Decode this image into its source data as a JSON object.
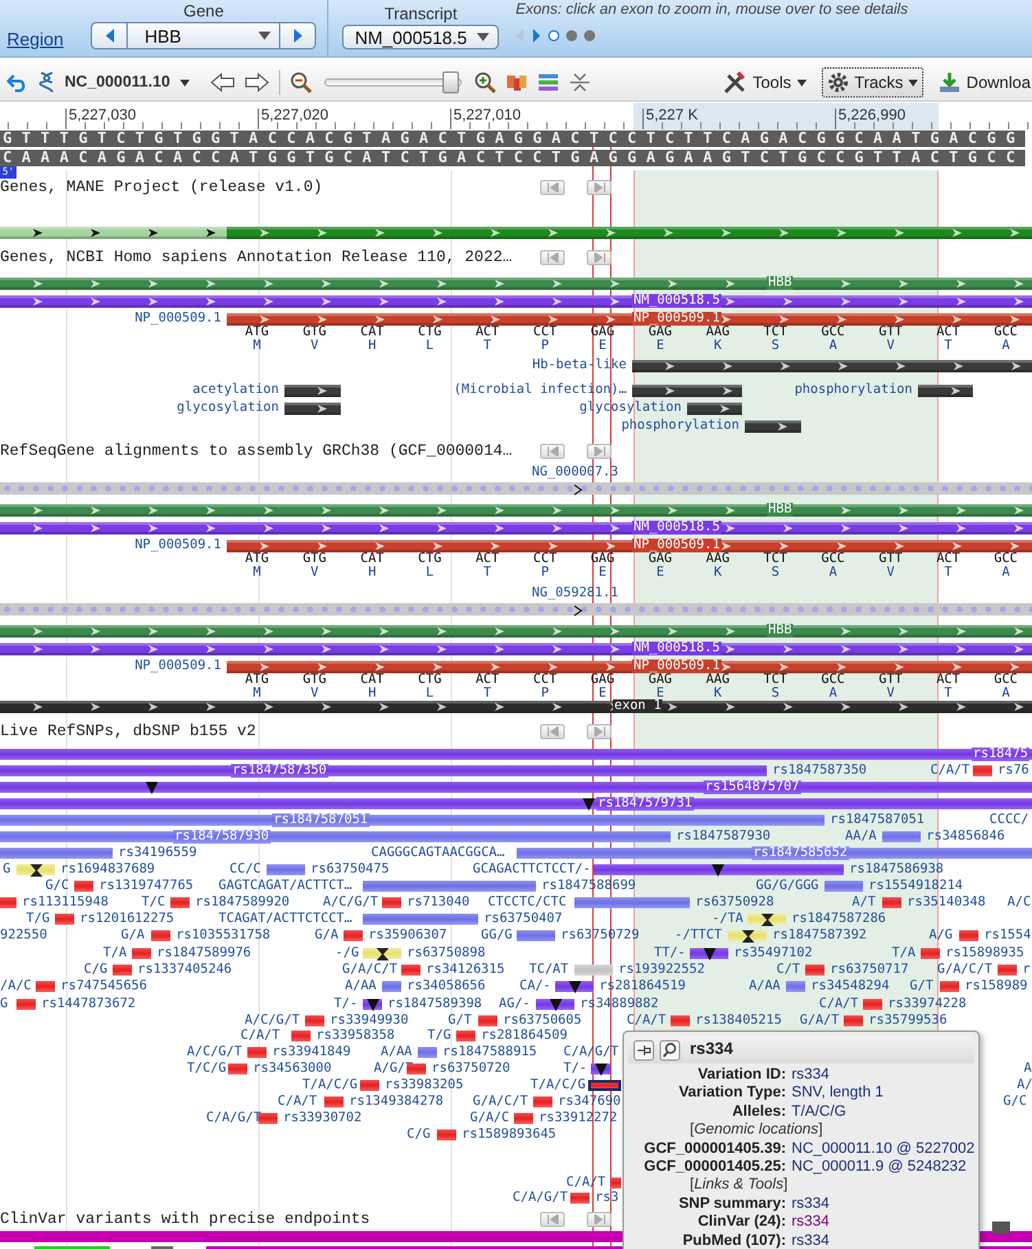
{
  "header": {
    "region_link": "Region",
    "gene": {
      "label": "Gene",
      "value": "HBB"
    },
    "transcript": {
      "label": "Transcript",
      "value": "NM_000518.5"
    },
    "exon_hint": "Exons: click an exon to zoom in, mouse over to see details",
    "exons": [
      {
        "selected": true
      },
      {
        "selected": false
      },
      {
        "selected": false
      }
    ]
  },
  "toolbar": {
    "accession": "NC_000011.10",
    "zoom_slider": {
      "level": 0.92
    },
    "tools": "Tools",
    "tracks": "Tracks",
    "download": "Downloa"
  },
  "ruler": {
    "ticks": [
      "5,227,030",
      "5,227,020",
      "5,227,010",
      "5,227 K",
      "5,226,990"
    ]
  },
  "sequence": {
    "forward": "GTTTGTCTGTGGTACCACGTAGACTGAGGACTCCTCTTCAGACGGCAATGACGG",
    "reverse": "CAAACAGACACCATGGTGCATCTGACTCCTGAGGAGAAGTCTGCCGTTACTGCC",
    "strand_badge": "5'"
  },
  "tracks": [
    {
      "kind": "mane",
      "title": "Genes, MANE Project (release v1.0)"
    },
    {
      "kind": "genes",
      "title": "Genes, NCBI Homo sapiens Annotation Release 110, 2022…",
      "gene": "HBB",
      "transcript": "NM_000518.5",
      "protein_outside": "NP_000509.1",
      "protein": "NP_000509.1",
      "codons": [
        {
          "codon": "ATG",
          "aa": "M"
        },
        {
          "codon": "GTG",
          "aa": "V"
        },
        {
          "codon": "CAT",
          "aa": "H"
        },
        {
          "codon": "CTG",
          "aa": "L"
        },
        {
          "codon": "ACT",
          "aa": "T"
        },
        {
          "codon": "CCT",
          "aa": "P"
        },
        {
          "codon": "GAG",
          "aa": "E"
        },
        {
          "codon": "GAG",
          "aa": "E"
        },
        {
          "codon": "AAG",
          "aa": "K"
        },
        {
          "codon": "TCT",
          "aa": "S"
        },
        {
          "codon": "GCC",
          "aa": "A"
        },
        {
          "codon": "GTT",
          "aa": "V"
        },
        {
          "codon": "ACT",
          "aa": "T"
        },
        {
          "codon": "GCC",
          "aa": "A"
        }
      ],
      "features": [
        {
          "label": "Hb-beta-like"
        },
        {
          "label": "acetylation"
        },
        {
          "label": "glycosylation"
        },
        {
          "label": "(Microbial infection)…"
        },
        {
          "label": "phosphorylation"
        },
        {
          "label": "glycosylation"
        },
        {
          "label": "phosphorylation"
        }
      ]
    },
    {
      "kind": "alignments",
      "title": "RefSeqGene alignments to assembly GRCh38 (GCF_0000014…",
      "alignments": [
        {
          "accession": "NG_000007.3",
          "gene": "HBB",
          "transcript": "NM_000518.5",
          "protein_outside": "NP_000509.1",
          "protein": "NP_000509.1",
          "codons": [
            {
              "codon": "ATG",
              "aa": "M"
            },
            {
              "codon": "GTG",
              "aa": "V"
            },
            {
              "codon": "CAT",
              "aa": "H"
            },
            {
              "codon": "CTG",
              "aa": "L"
            },
            {
              "codon": "ACT",
              "aa": "T"
            },
            {
              "codon": "CCT",
              "aa": "P"
            },
            {
              "codon": "GAG",
              "aa": "E"
            },
            {
              "codon": "GAG",
              "aa": "E"
            },
            {
              "codon": "AAG",
              "aa": "K"
            },
            {
              "codon": "TCT",
              "aa": "S"
            },
            {
              "codon": "GCC",
              "aa": "A"
            },
            {
              "codon": "GTT",
              "aa": "V"
            },
            {
              "codon": "ACT",
              "aa": "T"
            },
            {
              "codon": "GCC",
              "aa": "A"
            }
          ]
        },
        {
          "accession": "NG_059281.1",
          "gene": "HBB",
          "transcript": "NM_000518.5",
          "protein_outside": "NP_000509.1",
          "protein": "NP_000509.1",
          "codons": [
            {
              "codon": "ATG",
              "aa": "M"
            },
            {
              "codon": "GTG",
              "aa": "V"
            },
            {
              "codon": "CAT",
              "aa": "H"
            },
            {
              "codon": "CTG",
              "aa": "L"
            },
            {
              "codon": "ACT",
              "aa": "T"
            },
            {
              "codon": "CCT",
              "aa": "P"
            },
            {
              "codon": "GAG",
              "aa": "E"
            },
            {
              "codon": "GAG",
              "aa": "E"
            },
            {
              "codon": "AAG",
              "aa": "K"
            },
            {
              "codon": "TCT",
              "aa": "S"
            },
            {
              "codon": "GCC",
              "aa": "A"
            },
            {
              "codon": "GTT",
              "aa": "V"
            },
            {
              "codon": "ACT",
              "aa": "T"
            },
            {
              "codon": "GCC",
              "aa": "A"
            }
          ],
          "exon": "exon 1"
        }
      ]
    },
    {
      "kind": "snps",
      "title": "Live RefSNPs, dbSNP b155 v2",
      "lanes": [
        {
          "variants": [
            {
              "kind": "purple",
              "inside_label": "rs18475",
              "selected": false
            }
          ]
        },
        {
          "variants": [
            {
              "kind": "purple",
              "inside_label": "rs1847587350",
              "label": "rs1847587350",
              "selected": false
            },
            {
              "allele": "C/A/T",
              "kind": "red",
              "label": "rs76",
              "selected": false
            }
          ]
        },
        {
          "variants": [
            {
              "kind": "purple",
              "deletion": true,
              "inside_label": "rs1564875707",
              "selected": false
            }
          ]
        },
        {
          "variants": [
            {
              "kind": "purple",
              "deletion": true,
              "inside_label": "rs1847579731",
              "selected": false
            }
          ]
        },
        {
          "variants": [
            {
              "kind": "blue",
              "inside_label": "rs1847587051",
              "label": "rs1847587051",
              "selected": false
            },
            {
              "allele": "CCCC/",
              "kind": "none",
              "selected": false
            }
          ]
        },
        {
          "variants": [
            {
              "kind": "blue",
              "inside_label": "rs1847587930",
              "label": "rs1847587930",
              "selected": false
            },
            {
              "allele": "AA/A",
              "kind": "blue",
              "label": "rs34856846",
              "selected": false
            }
          ]
        },
        {
          "variants": [
            {
              "kind": "blue",
              "label": "rs34196559",
              "selected": false
            },
            {
              "allele": "CAGGGCAGTAACGGCA…",
              "kind": "blue",
              "inside_label": "rs1847585652",
              "selected": false
            }
          ]
        },
        {
          "variants": [
            {
              "allele": "G",
              "kind": "yellow",
              "insertion": true,
              "label": "rs1694837689",
              "selected": false
            },
            {
              "allele": "CC/C",
              "kind": "blue",
              "label": "rs63750475",
              "selected": false
            },
            {
              "allele": "GCAGACTTCTCCT/-",
              "kind": "purple",
              "deletion": true,
              "label": "rs1847586938",
              "selected": false
            }
          ]
        },
        {
          "variants": [
            {
              "allele": "G/C",
              "kind": "red",
              "label": "rs1319747765",
              "selected": false
            },
            {
              "allele": "GAGTCAGAT/ACTTCT…",
              "kind": "blue",
              "label": "rs1847588699",
              "selected": false
            },
            {
              "allele": "GG/G/GGG",
              "kind": "blue",
              "label": "rs1554918214",
              "selected": false
            }
          ]
        },
        {
          "variants": [
            {
              "kind": "red",
              "label": "rs113115948",
              "selected": false
            },
            {
              "allele": "T/C",
              "kind": "red",
              "label": "rs1847589920",
              "selected": false
            },
            {
              "allele": "A/C/G/T",
              "kind": "red",
              "label": "rs713040",
              "selected": false
            },
            {
              "allele": "CTCCTC/CTC",
              "kind": "blue",
              "label": "rs63750928",
              "selected": false
            },
            {
              "allele": "A/T",
              "kind": "red",
              "label": "rs35140348",
              "selected": false
            },
            {
              "allele": "A/C",
              "kind": "none",
              "selected": false
            }
          ]
        },
        {
          "variants": [
            {
              "allele": "T/G",
              "kind": "red",
              "label": "rs1201612275",
              "selected": false
            },
            {
              "allele": "TCAGAT/ACTTCTCCT…",
              "kind": "blue",
              "label": "rs63750407",
              "selected": false
            },
            {
              "allele": "-/TA",
              "kind": "yellow",
              "insertion": true,
              "label": "rs1847587286",
              "selected": false
            }
          ]
        },
        {
          "variants": [
            {
              "kind": "none",
              "label": "922550",
              "selected": false
            },
            {
              "allele": "G/A",
              "kind": "red",
              "label": "rs1035531758",
              "selected": false
            },
            {
              "allele": "G/A",
              "kind": "red",
              "label": "rs35906307",
              "selected": false
            },
            {
              "allele": "GG/G",
              "kind": "blue",
              "label": "rs63750729",
              "selected": false
            },
            {
              "allele": "-/TTCT",
              "kind": "yellow",
              "insertion": true,
              "label": "rs1847587392",
              "selected": false
            },
            {
              "allele": "A/G",
              "kind": "red",
              "label": "rs1554",
              "selected": false
            }
          ]
        },
        {
          "variants": [
            {
              "allele": "T/A",
              "kind": "red",
              "label": "rs1847589976",
              "selected": false
            },
            {
              "allele": "-/G",
              "kind": "yellow",
              "insertion": true,
              "label": "rs63750898",
              "selected": false
            },
            {
              "allele": "TT/-",
              "kind": "purple",
              "deletion": true,
              "label": "rs35497102",
              "selected": false
            },
            {
              "allele": "T/A",
              "kind": "red",
              "label": "rs15898935",
              "selected": false
            }
          ]
        },
        {
          "variants": [
            {
              "allele": "C/G",
              "kind": "red",
              "label": "rs1337405246",
              "selected": false
            },
            {
              "allele": "G/A/C/T",
              "kind": "red",
              "label": "rs34126315",
              "selected": false
            },
            {
              "allele": "TC/AT",
              "kind": "grey",
              "label": "rs193922552",
              "selected": false
            },
            {
              "allele": "C/T",
              "kind": "red",
              "label": "rs63750717",
              "selected": false
            },
            {
              "allele": "G/A/C/T",
              "kind": "red",
              "label": "r",
              "selected": false
            }
          ]
        },
        {
          "variants": [
            {
              "allele": "/A/C",
              "kind": "red",
              "label": "rs747545656",
              "selected": false
            },
            {
              "allele": "A/AA",
              "kind": "blue",
              "label": "rs34058656",
              "selected": false
            },
            {
              "allele": "CA/-",
              "kind": "purple",
              "deletion": true,
              "label": "rs281864519",
              "selected": false
            },
            {
              "allele": "A/AA",
              "kind": "blue",
              "label": "rs34548294",
              "selected": false
            },
            {
              "allele": "G/T",
              "kind": "red",
              "label": "rs158989",
              "selected": false
            }
          ]
        },
        {
          "variants": [
            {
              "allele": "G",
              "kind": "red",
              "label": "rs1447873672",
              "selected": false
            },
            {
              "allele": "T/-",
              "kind": "purple",
              "deletion": true,
              "label": "rs1847589398",
              "selected": false
            },
            {
              "allele": "AG/-",
              "kind": "purple",
              "deletion": true,
              "label": "rs34889882",
              "selected": false
            },
            {
              "allele": "C/A/T",
              "kind": "red",
              "label": "rs33974228",
              "selected": false
            }
          ]
        },
        {
          "variants": [
            {
              "allele": "A/C/G/T",
              "kind": "red",
              "label": "rs33949930",
              "selected": false
            },
            {
              "allele": "G/T",
              "kind": "red",
              "label": "rs63750605",
              "selected": false
            },
            {
              "allele": "C/A/T",
              "kind": "red",
              "label": "rs138405215",
              "selected": false
            },
            {
              "allele": "G/A/T",
              "kind": "red",
              "label": "rs35799536",
              "selected": false
            }
          ]
        },
        {
          "variants": [
            {
              "allele": "C/A/T",
              "kind": "red",
              "label": "rs33958358",
              "selected": false
            },
            {
              "allele": "T/G",
              "kind": "red",
              "label": "rs281864509",
              "selected": false
            }
          ]
        },
        {
          "variants": [
            {
              "allele": "A/C/G/T",
              "kind": "red",
              "label": "rs33941849",
              "selected": false
            },
            {
              "allele": "A/AA",
              "kind": "blue",
              "label": "rs1847588915",
              "selected": false
            },
            {
              "allele": "C/A/G/T",
              "kind": "none",
              "selected": false
            }
          ]
        },
        {
          "variants": [
            {
              "allele": "T/C/G",
              "kind": "red",
              "label": "rs34563000",
              "selected": false
            },
            {
              "allele": "A/G/T",
              "kind": "red",
              "label": "rs63750720",
              "selected": false
            },
            {
              "allele": "T/-",
              "kind": "purple",
              "deletion": true,
              "selected": false
            },
            {
              "allele": "A",
              "kind": "none",
              "selected": false
            }
          ]
        },
        {
          "variants": [
            {
              "allele": "T/A/C/G",
              "kind": "red",
              "label": "rs33983205",
              "selected": false
            },
            {
              "allele": "T/A/C/G",
              "kind": "red",
              "selected": true
            },
            {
              "allele": "A/",
              "kind": "none",
              "selected": false
            }
          ]
        },
        {
          "variants": [
            {
              "allele": "C/A/T",
              "kind": "red",
              "label": "rs1349384278",
              "selected": false
            },
            {
              "allele": "G/A/C/T",
              "kind": "red",
              "label": "rs347690",
              "selected": false
            },
            {
              "allele": "G/C",
              "kind": "none",
              "selected": false
            }
          ]
        },
        {
          "variants": [
            {
              "allele": "C/A/G/T",
              "kind": "red",
              "label": "rs33930702",
              "selected": false
            },
            {
              "allele": "G/A/C",
              "kind": "red",
              "label": "rs33912272",
              "selected": false
            }
          ]
        },
        {
          "variants": [
            {
              "allele": "C/G",
              "kind": "red",
              "label": "rs1589893645",
              "selected": false
            }
          ]
        },
        {
          "variants": [
            {
              "allele": "C/A/T",
              "kind": "red",
              "selected": false
            }
          ]
        },
        {
          "variants": [
            {
              "allele": "C/A/G/T",
              "kind": "red",
              "label": "rs3",
              "selected": false
            }
          ]
        }
      ]
    },
    {
      "kind": "clinvar",
      "title": "ClinVar variants with precise endpoints"
    }
  ],
  "popup": {
    "title": "rs334",
    "rows": [
      {
        "kind": "field",
        "label": "Variation ID:",
        "value": "rs334"
      },
      {
        "kind": "field",
        "label": "Variation Type:",
        "value": "SNV, length 1"
      },
      {
        "kind": "field",
        "label": "Alleles:",
        "value": "T/A/C/G"
      },
      {
        "kind": "section",
        "text": "[*Genomic locations*]"
      },
      {
        "kind": "field",
        "label": "GCF_000001405.39:",
        "value": "NC_000011.10 @ 5227002"
      },
      {
        "kind": "field",
        "label": "GCF_000001405.25:",
        "value": "NC_000011.9 @ 5248232"
      },
      {
        "kind": "section",
        "text": "[*Links & Tools*]"
      },
      {
        "kind": "link",
        "label": "SNP summary:",
        "value": "rs334",
        "visited": false
      },
      {
        "kind": "link",
        "label": "ClinVar (24):",
        "value": "rs334",
        "visited": true
      },
      {
        "kind": "link",
        "label": "PubMed (107):",
        "value": "rs334",
        "visited": false
      }
    ]
  }
}
